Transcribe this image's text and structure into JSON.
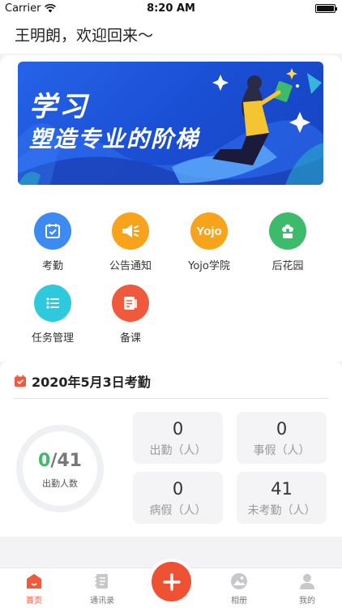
{
  "status_bar": {
    "carrier": "Carrier",
    "time": "8:20 AM"
  },
  "greeting": "王明朗，欢迎回来～",
  "banner": {
    "title": "学习",
    "subtitle": "塑造专业的阶梯"
  },
  "grid": [
    {
      "label": "考勤",
      "icon": "calendar-check-icon",
      "color": "#3d8bf0"
    },
    {
      "label": "公告通知",
      "icon": "megaphone-icon",
      "color": "#f7a41c"
    },
    {
      "label": "Yojo学院",
      "icon": "yojo-logo-icon",
      "color": "#f7a41c"
    },
    {
      "label": "后花园",
      "icon": "flower-icon",
      "color": "#3dbb6b"
    },
    {
      "label": "任务管理",
      "icon": "list-icon",
      "color": "#2ec9dc"
    },
    {
      "label": "备课",
      "icon": "notebook-icon",
      "color": "#ef5a3c"
    }
  ],
  "attendance": {
    "title": "2020年5月3日考勤",
    "present": "0",
    "total": "41",
    "ring_label": "出勤人数",
    "stats": [
      {
        "value": "0",
        "label": "出勤（人）"
      },
      {
        "value": "0",
        "label": "事假（人）"
      },
      {
        "value": "0",
        "label": "病假（人）"
      },
      {
        "value": "41",
        "label": "未考勤（人）"
      }
    ]
  },
  "tabs": [
    {
      "label": "首页",
      "icon": "home-icon",
      "active": true
    },
    {
      "label": "通讯录",
      "icon": "contacts-book-icon",
      "active": false
    },
    {
      "label": "相册",
      "icon": "album-icon",
      "active": false
    },
    {
      "label": "我的",
      "icon": "user-icon",
      "active": false
    }
  ],
  "colors": {
    "accent": "#ef5a3c",
    "present_green": "#3dbb6b",
    "banner_blue": "#1f55e0"
  }
}
